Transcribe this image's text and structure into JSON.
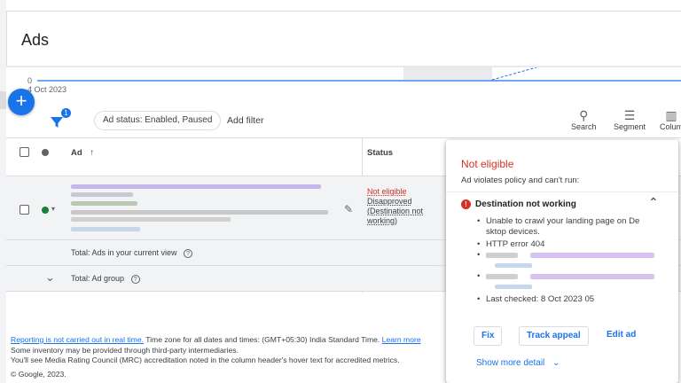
{
  "page": {
    "title": "Ads"
  },
  "chart": {
    "zero_label": "0",
    "date_label": "4 Oct 2023"
  },
  "fab": {
    "label": "+"
  },
  "toolbar": {
    "filter_badge": "1",
    "status_chip": "Ad status: Enabled, Paused",
    "add_filter": "Add filter",
    "search": "Search",
    "segment": "Segment",
    "columns": "Colum"
  },
  "table": {
    "headers": {
      "ad": "Ad",
      "status": "Status",
      "sort_arrow": "↑"
    },
    "row": {
      "status_not_eligible": "Not eligible",
      "status_disapproved": "Disapproved",
      "status_reason_1": "(Destination not",
      "status_reason_2": "working)"
    },
    "totals": {
      "current_view": "Total: Ads in your current view",
      "ad_group": "Total: Ad group"
    }
  },
  "footer": {
    "link_reporting": "Reporting is not carried out in real time.",
    "timezone": " Time zone for all dates and times: (GMT+05:30) India Standard Time. ",
    "learn_more": "Learn more",
    "line2": "Some inventory may be provided through third-party intermediaries.",
    "line3": "You'll see Media Rating Council (MRC) accreditation noted in the column header's hover text for accredited metrics.",
    "copyright": "© Google, 2023."
  },
  "popup": {
    "title": "Not eligible",
    "subtitle": "Ad violates policy and can't run:",
    "reason": "Destination not working",
    "bullet_1": "Unable to crawl your landing page on De sktop devices.",
    "bullet_2": "HTTP error 404",
    "bullet_last": "Last checked: 8 Oct 2023 05",
    "btn_fix": "Fix",
    "btn_track": "Track appeal",
    "link_edit": "Edit ad",
    "show_more": "Show more detail"
  },
  "colors": {
    "accent": "#1a73e8",
    "error": "#d93025",
    "enabled": "#188038"
  }
}
